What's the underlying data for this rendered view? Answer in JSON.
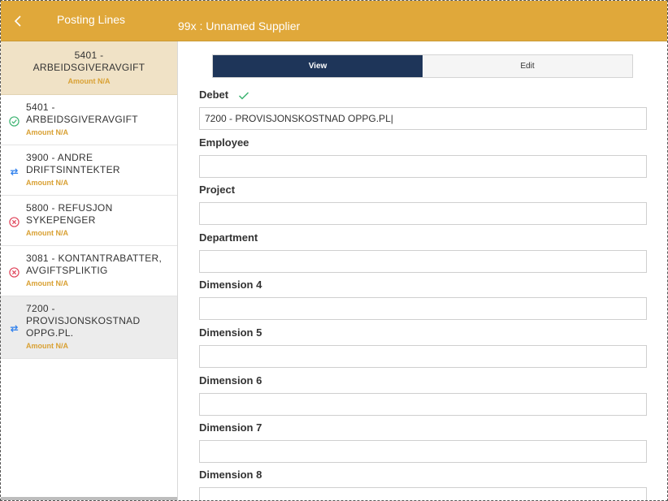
{
  "header": {
    "left_title": "Posting Lines",
    "title": "99x : Unnamed Supplier"
  },
  "sidebar": {
    "selected": {
      "account": "5401 - ARBEIDSGIVERAVGIFT",
      "amount": "Amount N/A"
    },
    "items": [
      {
        "account_line1": "5401 -",
        "account_line2": "ARBEIDSGIVERAVGIFT",
        "account_line3": "",
        "amount": "Amount N/A",
        "status": "check"
      },
      {
        "account_line1": "3900 - ANDRE",
        "account_line2": "DRIFTSINNTEKTER",
        "account_line3": "",
        "amount": "Amount N/A",
        "status": "swap"
      },
      {
        "account_line1": "5800 - REFUSJON",
        "account_line2": "SYKEPENGER",
        "account_line3": "",
        "amount": "Amount N/A",
        "status": "error"
      },
      {
        "account_line1": "3081 - KONTANTRABATTER,",
        "account_line2": "AVGIFTSPLIKTIG",
        "account_line3": "",
        "amount": "Amount N/A",
        "status": "error"
      },
      {
        "account_line1": "7200 -",
        "account_line2": "PROVISJONSKOSTNAD",
        "account_line3": "OPPG.PL.",
        "amount": "Amount N/A",
        "status": "swap"
      }
    ]
  },
  "toggle": {
    "view": "View",
    "edit": "Edit"
  },
  "fields": {
    "debet": {
      "label": "Debet",
      "value": "7200 - PROVISJONSKOSTNAD OPPG.PL|"
    },
    "employee": {
      "label": "Employee",
      "value": ""
    },
    "project": {
      "label": "Project",
      "value": ""
    },
    "department": {
      "label": "Department",
      "value": ""
    },
    "dimension4": {
      "label": "Dimension 4",
      "value": ""
    },
    "dimension5": {
      "label": "Dimension 5",
      "value": ""
    },
    "dimension6": {
      "label": "Dimension 6",
      "value": ""
    },
    "dimension7": {
      "label": "Dimension 7",
      "value": ""
    },
    "dimension8": {
      "label": "Dimension 8",
      "value": ""
    }
  },
  "colors": {
    "header": "#e0a83a",
    "selected_bg": "#f0e2c6",
    "amount": "#d9a134",
    "toggle_active": "#1e3559",
    "check": "#3cb371",
    "swap": "#2f80ed",
    "error": "#e0455b"
  }
}
